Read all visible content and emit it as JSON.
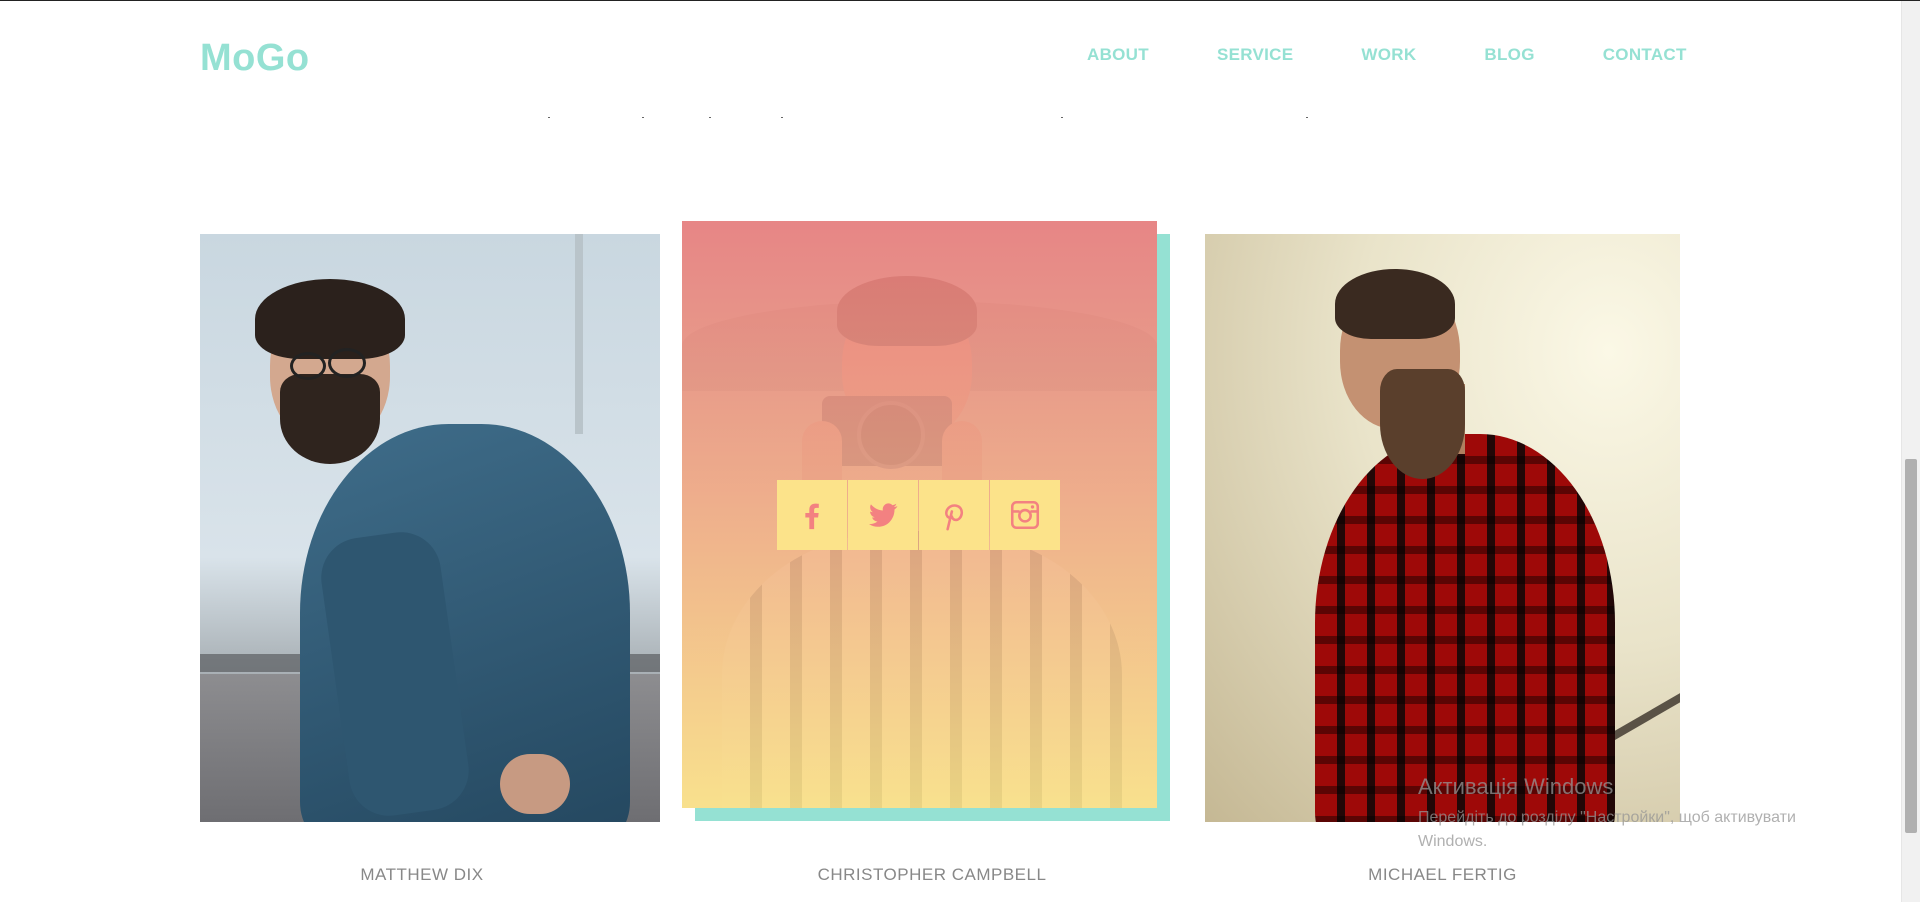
{
  "header": {
    "logo": "MoGo",
    "nav": [
      "ABOUT",
      "SERVICE",
      "WORK",
      "BLOG",
      "CONTACT"
    ]
  },
  "team": [
    {
      "name": "MATTHEW DIX"
    },
    {
      "name": "CHRISTOPHER CAMPBELL"
    },
    {
      "name": "MICHAEL FERTIG"
    }
  ],
  "socials": [
    "facebook-icon",
    "twitter-icon",
    "pinterest-icon",
    "instagram-icon"
  ],
  "windows_activation": {
    "title": "Активація Windows",
    "subtitle": "Перейдіть до розділу \"Настройки\", щоб активувати Windows."
  },
  "colors": {
    "accent": "#95e1d3",
    "overlay_top": "#f38181",
    "overlay_bottom": "#fce38a",
    "social_bg": "#fce38a",
    "social_icon": "#f38181",
    "name_text": "#888888"
  }
}
